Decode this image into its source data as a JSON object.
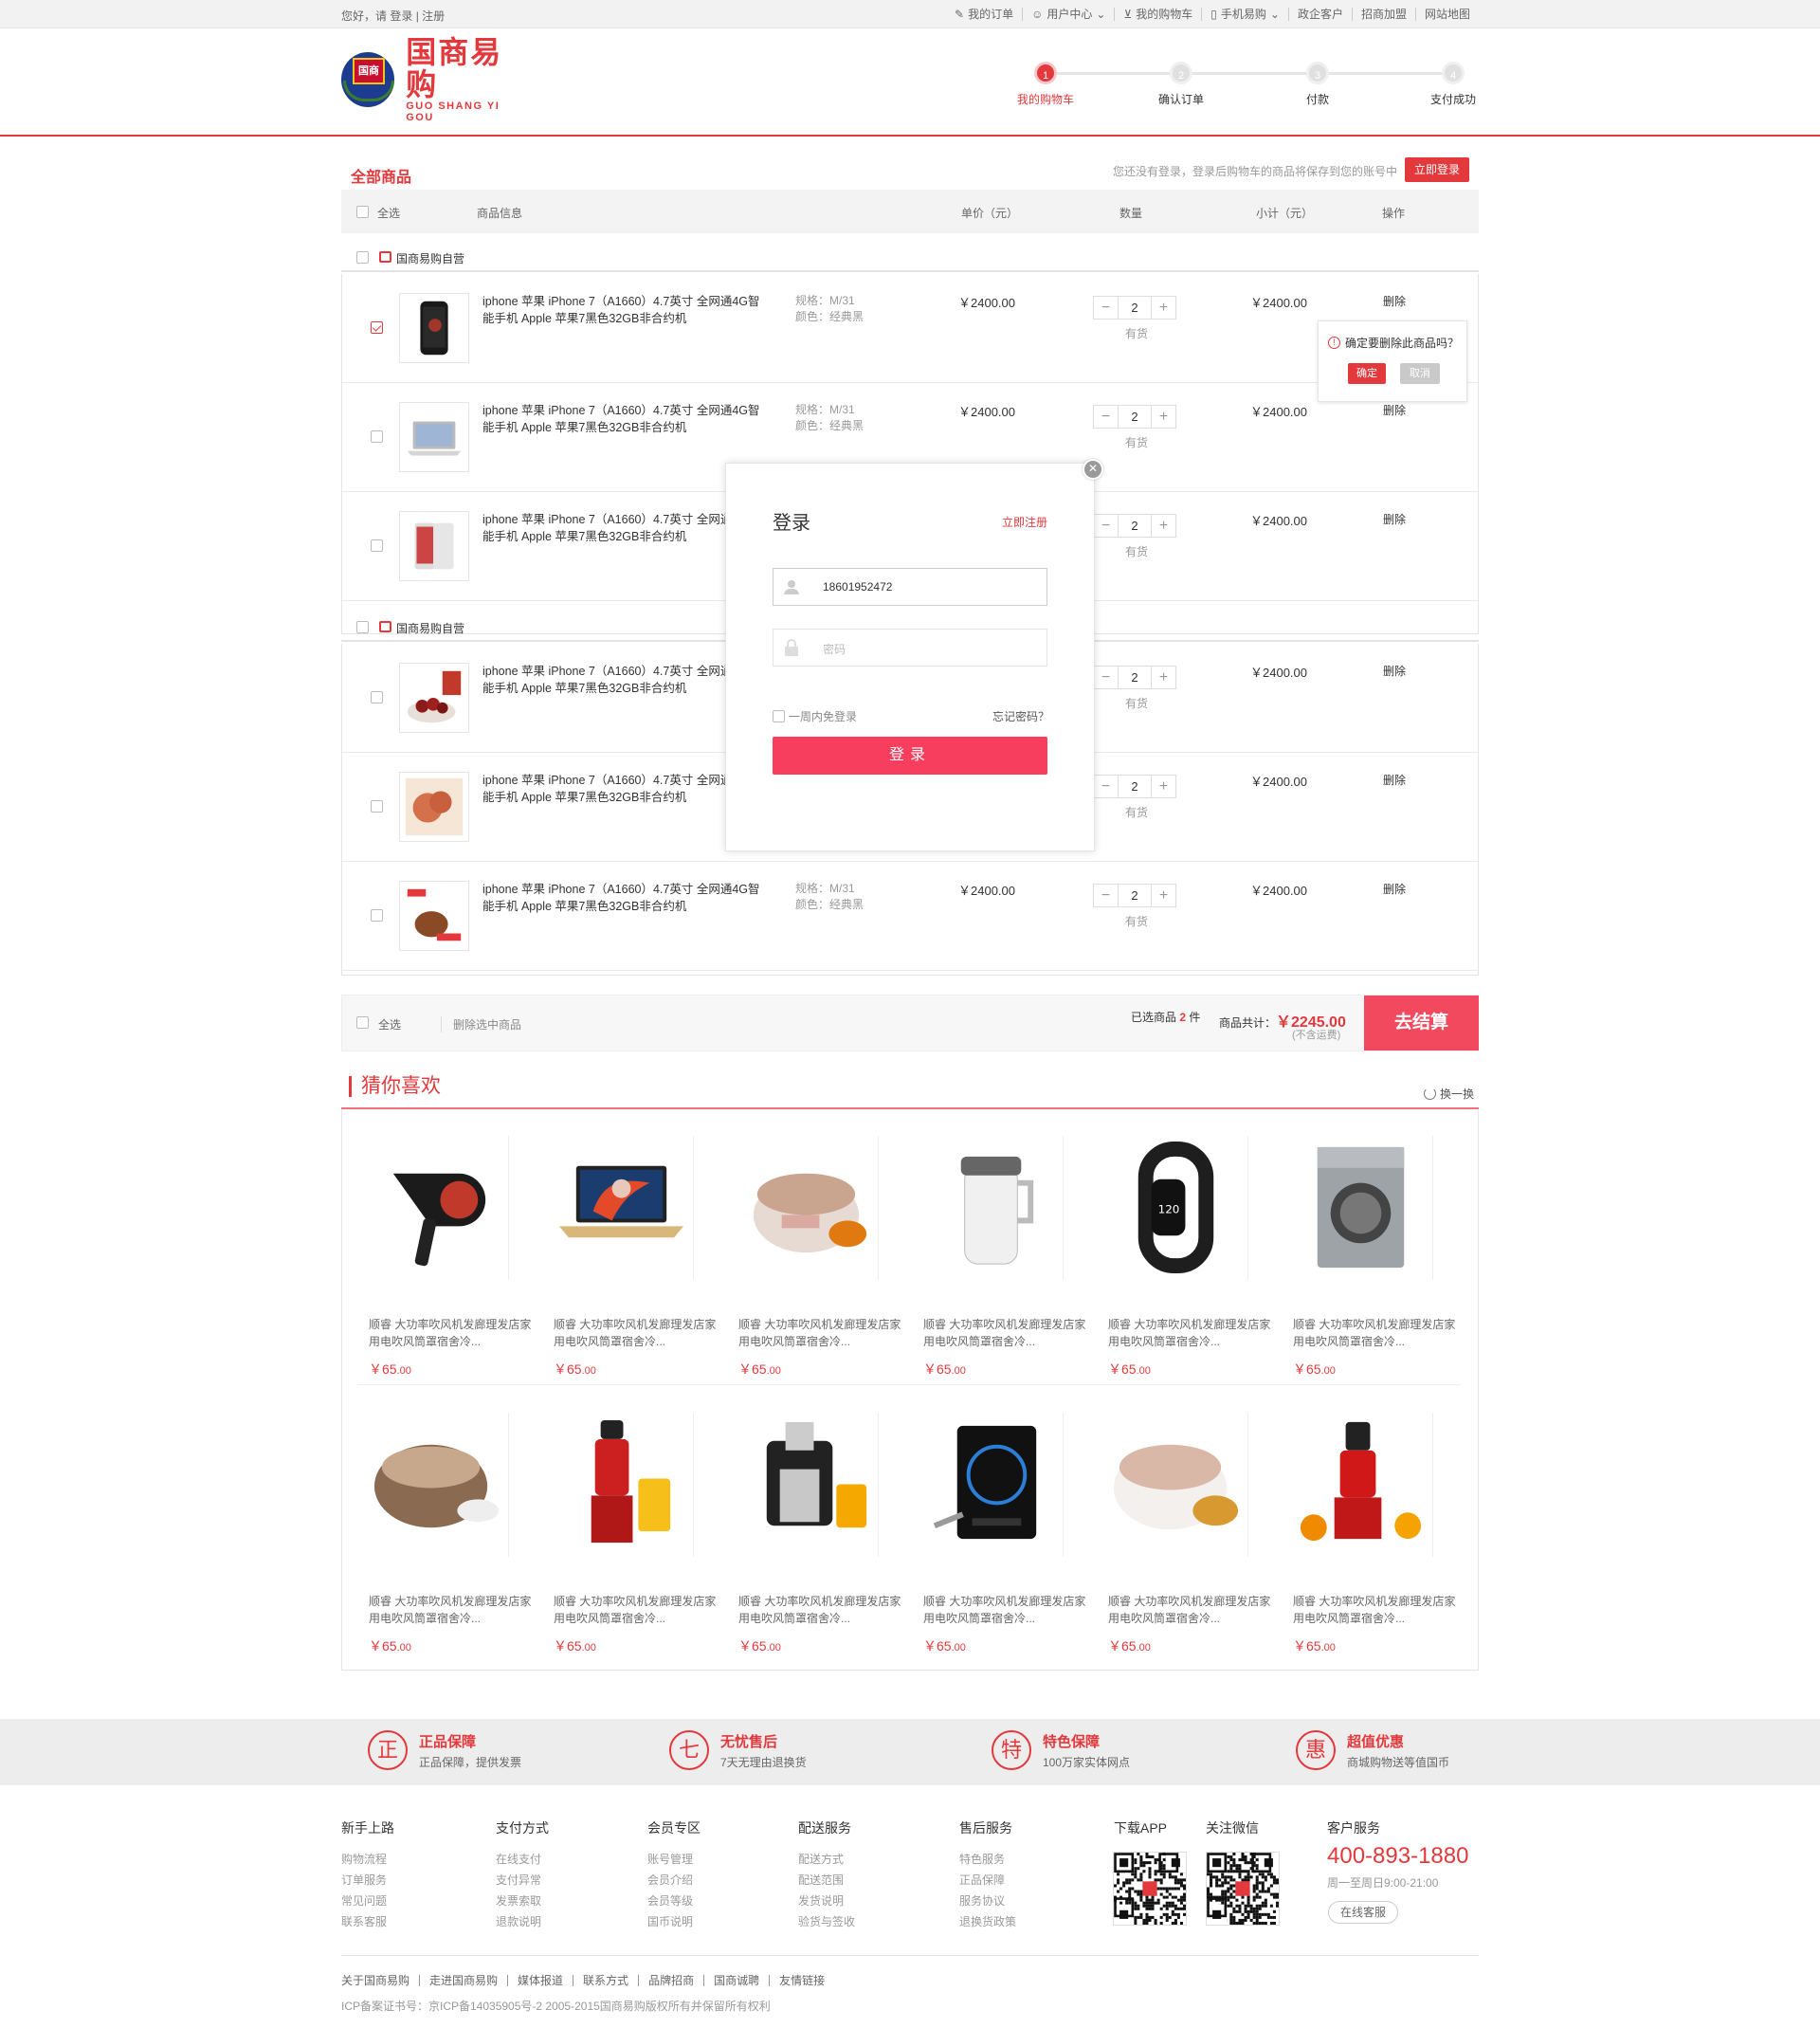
{
  "topbar": {
    "greeting": "您好，请",
    "login": "登录",
    "register": "注册",
    "links": [
      "我的订单",
      "用户中心",
      "我的购物车",
      "手机易购",
      "政企客户",
      "招商加盟",
      "网站地图"
    ]
  },
  "logo": {
    "cn": "国商易购",
    "en": "GUO SHANG YI GOU",
    "emblem_text": "国商"
  },
  "steps": [
    {
      "num": "1",
      "label": "我的购物车"
    },
    {
      "num": "2",
      "label": "确认订单"
    },
    {
      "num": "3",
      "label": "付款"
    },
    {
      "num": "4",
      "label": "支付成功"
    }
  ],
  "cart": {
    "title": "全部商品",
    "login_tip": "您还没有登录，登录后购物车的商品将保存到您的账号中",
    "login_now": "立即登录",
    "headers": {
      "select_all": "全选",
      "info": "商品信息",
      "price": "单价（元）",
      "qty": "数量",
      "subtotal": "小计（元）",
      "ops": "操作"
    },
    "shops": [
      {
        "name": "国商易购自营"
      },
      {
        "name": "国商易购自营"
      }
    ],
    "item_name": "iphone 苹果 iPhone 7（A1660）4.7英寸 全网通4G智能手机 Apple 苹果7黑色32GB非合约机",
    "item_name_l1": "iphone 苹果 iPhone 7（A1660）4.7英寸 全网通4G智",
    "item_name_l2": "能手机 Apple 苹果7黑色32GB非合约机",
    "spec_label": "规格：M/31",
    "color_label": "颜色：经典黑",
    "price": "￥2400.00",
    "qty": "2",
    "stock": "有货",
    "subtotal": "￥2400.00",
    "delete": "删除",
    "items_checked": [
      true,
      false,
      false,
      false,
      false,
      false
    ]
  },
  "popover": {
    "question": "确定要删除此商品吗？",
    "ok": "确定",
    "cancel": "取消"
  },
  "cart_footer": {
    "select_all": "全选",
    "delete_selected": "删除选中商品",
    "selected_prefix": "已选商品",
    "selected_count": "2",
    "selected_suffix": "件",
    "total_label": "商品共计：",
    "total": "￥2245.00",
    "tax_note": "(不含运费)",
    "checkout": "去结算"
  },
  "guess": {
    "title": "猜你喜欢",
    "refresh": "换一换",
    "product_name_l1": "顺睿 大功率吹风机发廊理发店家",
    "product_name_l2": "用电吹风筒罩宿舍冷...",
    "price_symbol": "￥",
    "price_int": "65",
    "price_dec": ".00",
    "row1": [
      "hair-dryer",
      "laptop",
      "rice-cooker",
      "soymilk-maker",
      "fitness-band",
      "washing-machine"
    ],
    "row2": [
      "rice-cooker-dark",
      "juicer-red",
      "juicer-steel",
      "induction-cooker",
      "rice-cooker-white",
      "slow-juicer"
    ]
  },
  "guarantees": [
    {
      "icon": "正",
      "title": "正品保障",
      "desc": "正品保障，提供发票"
    },
    {
      "icon": "七",
      "title": "无忧售后",
      "desc": "7天无理由退换货"
    },
    {
      "icon": "特",
      "title": "特色保障",
      "desc": "100万家实体网点"
    },
    {
      "icon": "惠",
      "title": "超值优惠",
      "desc": "商城购物送等值国币"
    }
  ],
  "footer": {
    "cols": [
      {
        "title": "新手上路",
        "links": [
          "购物流程",
          "订单服务",
          "常见问题",
          "联系客服"
        ]
      },
      {
        "title": "支付方式",
        "links": [
          "在线支付",
          "支付异常",
          "发票索取",
          "退款说明"
        ]
      },
      {
        "title": "会员专区",
        "links": [
          "账号管理",
          "会员介绍",
          "会员等级",
          "国币说明"
        ]
      },
      {
        "title": "配送服务",
        "links": [
          "配送方式",
          "配送范围",
          "发货说明",
          "验货与签收"
        ]
      },
      {
        "title": "售后服务",
        "links": [
          "特色服务",
          "正品保障",
          "服务协议",
          "退换货政策"
        ]
      }
    ],
    "app": "下载APP",
    "wechat": "关注微信",
    "service_title": "客户服务",
    "hotline": "400-893-1880",
    "hours": "周一至周日9:00-21:00",
    "online": "在线客服",
    "bottom_links": [
      "关于国商易购",
      "走进国商易购",
      "媒体报道",
      "联系方式",
      "品牌招商",
      "国商诚聘",
      "友情链接"
    ],
    "copyright": "ICP备案证书号：京ICP备14035905号-2  2005-2015国商易购版权所有并保留所有权利"
  },
  "modal": {
    "title": "登录",
    "register": "立即注册",
    "username": "18601952472",
    "password_placeholder": "密码",
    "remember": "一周内免登录",
    "forgot": "忘记密码？",
    "submit": "登录"
  },
  "colors": {
    "accent": "#e4393c",
    "button": "#f73e5e",
    "checkout": "#f2495f"
  }
}
